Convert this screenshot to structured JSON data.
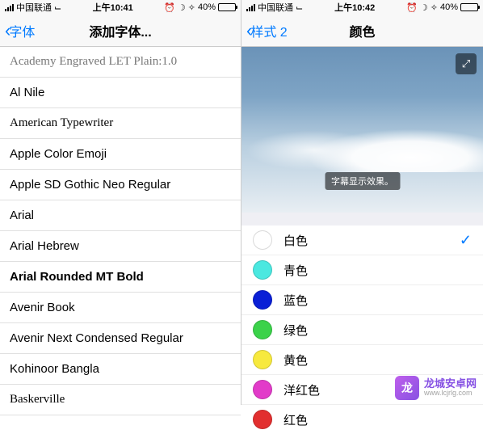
{
  "left": {
    "status": {
      "carrier": "中国联通",
      "time": "上午10:41",
      "battery": "40%"
    },
    "nav": {
      "back_label": "字体",
      "title": "添加字体..."
    },
    "fonts": [
      "Academy Engraved LET Plain:1.0",
      "Al Nile",
      "American Typewriter",
      "Apple Color Emoji",
      "Apple SD Gothic Neo Regular",
      "Arial",
      "Arial Hebrew",
      "Arial Rounded MT Bold",
      "Avenir Book",
      "Avenir Next Condensed Regular",
      "Kohinoor Bangla",
      "Baskerville"
    ]
  },
  "right": {
    "status": {
      "carrier": "中国联通",
      "time": "上午10:42",
      "battery": "40%"
    },
    "nav": {
      "back_label": "样式 2",
      "title": "颜色"
    },
    "preview": {
      "subtitle_text": "字幕显示效果。"
    },
    "colors": [
      {
        "label": "白色",
        "hex": "#ffffff",
        "selected": true
      },
      {
        "label": "青色",
        "hex": "#4be8e0",
        "selected": false
      },
      {
        "label": "蓝色",
        "hex": "#0a1fd6",
        "selected": false
      },
      {
        "label": "绿色",
        "hex": "#3bd24a",
        "selected": false
      },
      {
        "label": "黄色",
        "hex": "#f7e93e",
        "selected": false
      },
      {
        "label": "洋红色",
        "hex": "#e23bc9",
        "selected": false
      },
      {
        "label": "红色",
        "hex": "#e22f2f",
        "selected": false
      }
    ]
  },
  "watermark": {
    "name": "龙城安卓网",
    "url": "www.lcjrlg.com"
  }
}
